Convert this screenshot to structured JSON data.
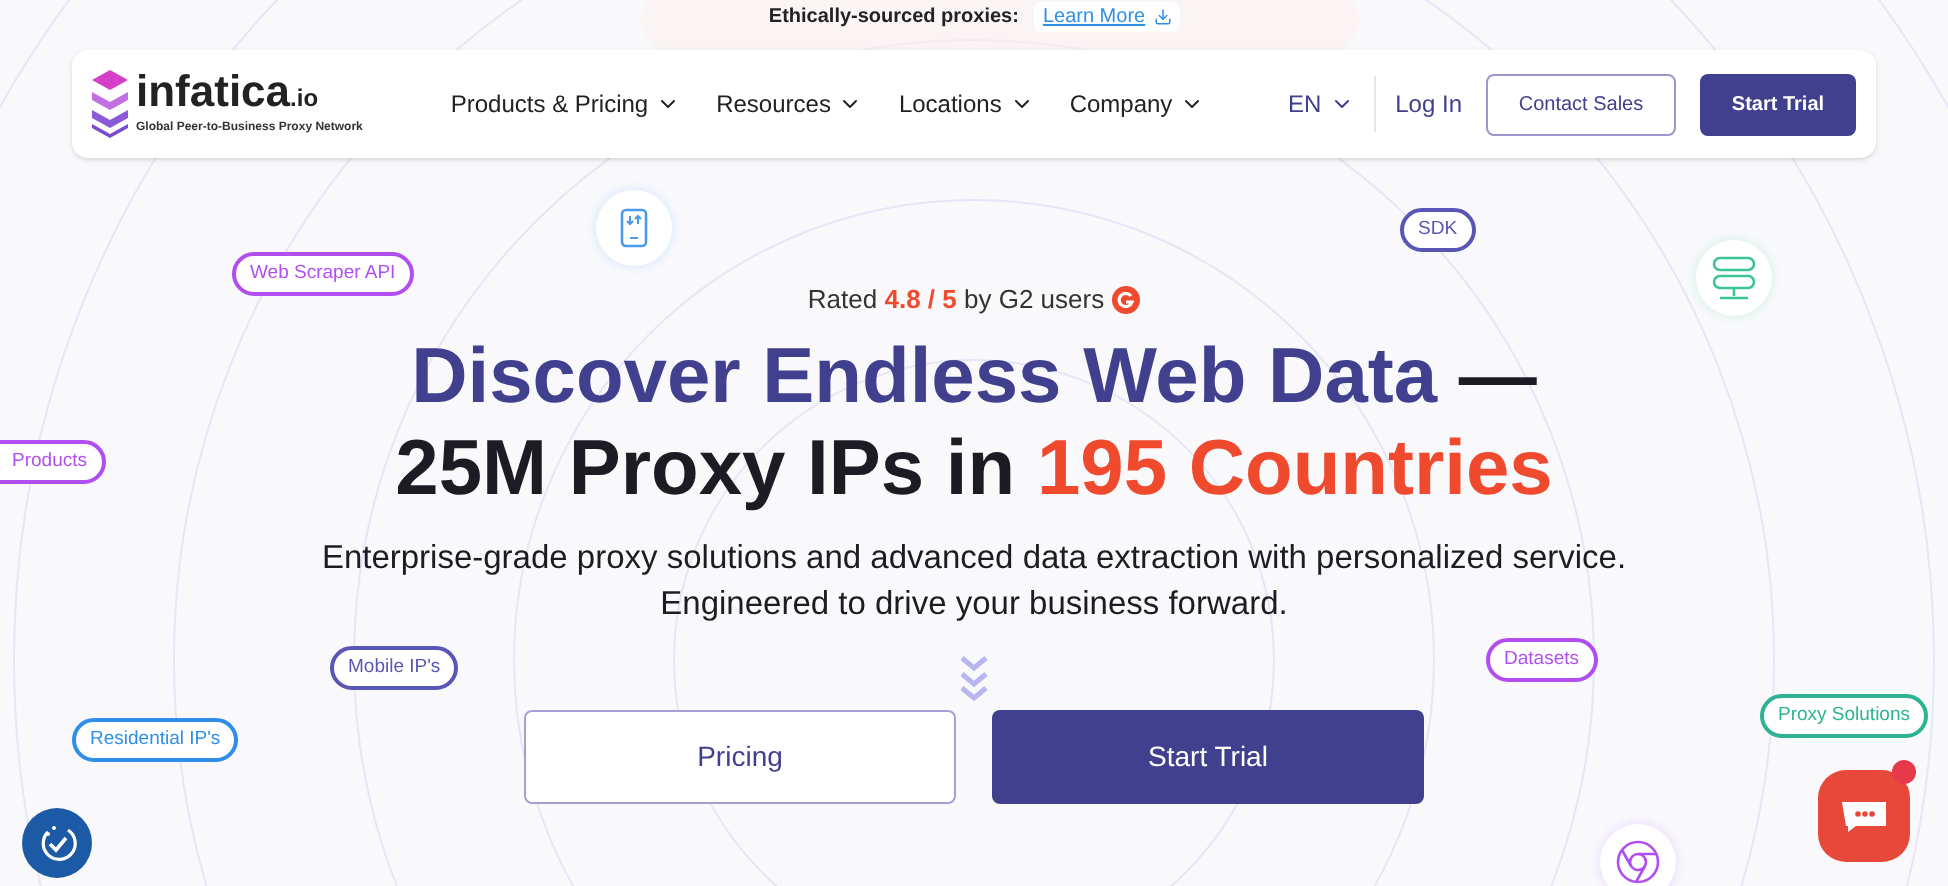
{
  "banner": {
    "text": "Ethically-sourced proxies:",
    "link": "Learn More"
  },
  "nav": {
    "logo": {
      "name": "infatica",
      "suffix": ".io",
      "tagline": "Global Peer-to-Business Proxy Network"
    },
    "menu": [
      "Products & Pricing",
      "Resources",
      "Locations",
      "Company"
    ],
    "language": "EN",
    "login": "Log In",
    "contact": "Contact Sales",
    "trial": "Start Trial"
  },
  "rating": {
    "prefix": "Rated",
    "score": "4.8 / 5",
    "suffix": "by G2 users"
  },
  "headline": [
    [
      {
        "text": "Discover Endless Web Data",
        "kind": "accent"
      },
      {
        "text": "—",
        "kind": "plain"
      }
    ],
    [
      {
        "text": "25M Proxy IPs in",
        "kind": "plain"
      },
      {
        "text": "195 Countries",
        "kind": "highlight"
      }
    ]
  ],
  "subtitle": [
    "Enterprise-grade proxy solutions and advanced data extraction with personalized service.",
    "Engineered to drive your business forward."
  ],
  "buttons": {
    "secondary": "Pricing",
    "primary": "Start Trial"
  },
  "chips": [
    {
      "label": "Web Scraper API",
      "color": "#b14ef0"
    },
    {
      "label": "SDK",
      "color": "#5a56b5"
    },
    {
      "label": "Products",
      "color": "#b14ef0"
    },
    {
      "label": "Mobile IP's",
      "color": "#5a56b5"
    },
    {
      "label": "Residential IP's",
      "color": "#2f8fe8"
    },
    {
      "label": "Datasets",
      "color": "#b14ef0"
    },
    {
      "label": "Proxy Solutions",
      "color": "#2db393"
    }
  ],
  "chat": {
    "unread": true
  }
}
